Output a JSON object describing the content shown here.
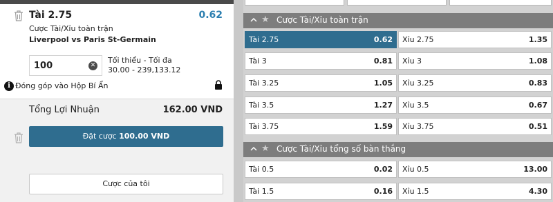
{
  "bet_slip": {
    "selection": {
      "title": "Tài 2.75",
      "odds": "0.62",
      "market": "Cược Tài/Xỉu toàn trận",
      "match": "Liverpool vs Paris St-Germain"
    },
    "stake": {
      "value": "100",
      "limit_label": "Tối thiểu - Tối đa",
      "limit_values": "30.00 - 239,133.12"
    },
    "jackpot_text": "Đóng góp vào Hộp Bí Ẩn",
    "profit": {
      "label": "Tổng Lợi Nhuận",
      "value": "162.00 VND"
    },
    "place_bet": {
      "prefix": "Đặt cược",
      "amount": "100.00 VND"
    },
    "my_bets_label": "Cược của tôi"
  },
  "markets": [
    {
      "title": "Cược Tài/Xỉu toàn trận",
      "rows": [
        {
          "over": {
            "label": "Tài 2.75",
            "price": "0.62",
            "selected": true
          },
          "under": {
            "label": "Xỉu 2.75",
            "price": "1.35"
          }
        },
        {
          "over": {
            "label": "Tài 3",
            "price": "0.81"
          },
          "under": {
            "label": "Xỉu 3",
            "price": "1.08"
          }
        },
        {
          "over": {
            "label": "Tài 3.25",
            "price": "1.05"
          },
          "under": {
            "label": "Xỉu 3.25",
            "price": "0.83"
          }
        },
        {
          "over": {
            "label": "Tài 3.5",
            "price": "1.27"
          },
          "under": {
            "label": "Xỉu 3.5",
            "price": "0.67"
          }
        },
        {
          "over": {
            "label": "Tài 3.75",
            "price": "1.59"
          },
          "under": {
            "label": "Xỉu 3.75",
            "price": "0.51"
          }
        }
      ]
    },
    {
      "title": "Cược Tài/Xỉu tổng số bàn thắng",
      "rows": [
        {
          "over": {
            "label": "Tài 0.5",
            "price": "0.02"
          },
          "under": {
            "label": "Xỉu 0.5",
            "price": "13.00"
          }
        },
        {
          "over": {
            "label": "Tài 1.5",
            "price": "0.16"
          },
          "under": {
            "label": "Xỉu 1.5",
            "price": "4.30"
          }
        }
      ]
    }
  ],
  "icons": {
    "trash": "trash-icon",
    "clear": "clear-icon",
    "info": "info-icon",
    "lock": "lock-icon",
    "collapse": "chevron-up-icon",
    "favorite": "star-icon"
  },
  "colors": {
    "accent": "#2f6d8f",
    "odds_text": "#2c7fb0",
    "market_header": "#7d7d7d"
  }
}
